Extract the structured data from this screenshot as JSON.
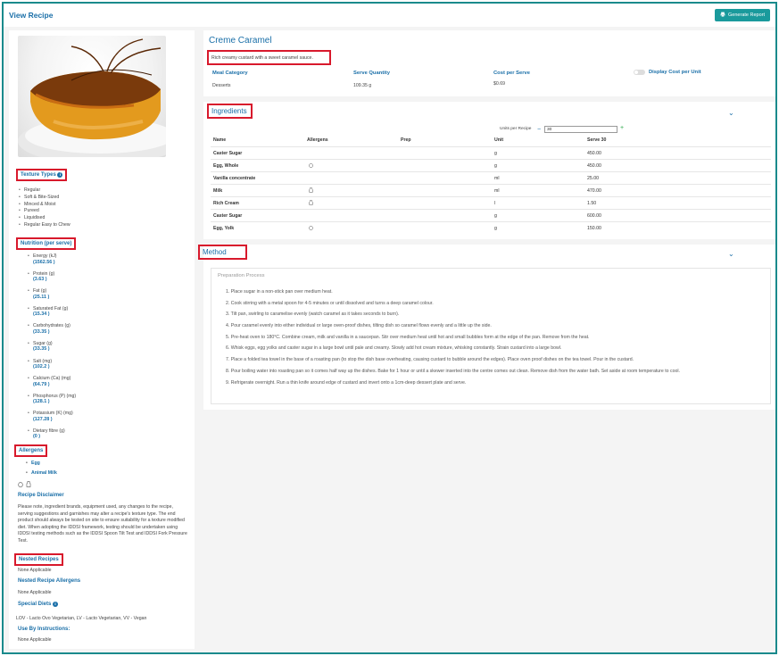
{
  "page": {
    "title": "View Recipe",
    "generate_report": "Generate Report"
  },
  "recipe": {
    "name": "Creme Caramel",
    "description": "Rich creamy custard with a sweet caramel sauce.",
    "meal_category_label": "Meal Category",
    "meal_category": "Desserts",
    "serve_quantity_label": "Serve Quantity",
    "serve_quantity": "109.35 g",
    "cost_per_serve_label": "Cost per Serve",
    "cost_per_serve": "$0.69",
    "display_cost_label": "Display Cost per Unit"
  },
  "sidebar": {
    "texture_types_title": "Texture Types",
    "texture_types": [
      "Regular",
      "Soft & Bite-Sized",
      "Minced & Moist",
      "Pureed",
      "Liquidised",
      "Regular Easy to Chew"
    ],
    "nutrition_title": "Nutrition (per serve)",
    "nutrition": [
      {
        "label": "Energy (kJ)",
        "value": "(1562.56 )"
      },
      {
        "label": "Protein (g)",
        "value": "(3.63 )"
      },
      {
        "label": "Fat (g)",
        "value": "(25.11 )"
      },
      {
        "label": "Saturated Fat (g)",
        "value": "(15.34 )"
      },
      {
        "label": "Carbohydrates (g)",
        "value": "(33.35 )"
      },
      {
        "label": "Sugar (g)",
        "value": "(33.35 )"
      },
      {
        "label": "Salt (mg)",
        "value": "(102.2 )"
      },
      {
        "label": "Calcium (Ca) (mg)",
        "value": "(64.79 )"
      },
      {
        "label": "Phosphorus (P) (mg)",
        "value": "(128.1 )"
      },
      {
        "label": "Potassium (K) (mg)",
        "value": "(127.28 )"
      },
      {
        "label": "Dietary fibre (g)",
        "value": "(0 )"
      }
    ],
    "allergens_title": "Allergens",
    "allergens": [
      "Egg",
      "Animal Milk"
    ],
    "disclaimer_title": "Recipe Disclaimer",
    "disclaimer_text": "Please note, ingredient brands, equipment used, any changes to the recipe, serving suggestions and garnishes may alter a recipe's texture type. The end product should always be tested on site to ensure suitability for a texture modified diet. When adopting the IDDSI framework, testing should be undertaken using IDDSI testing methods such as the IDDSI Spoon Tilt Test and IDDSI Fork Pressure Test.",
    "nested_recipes_title": "Nested Recipes",
    "nested_recipes_value": "None Applicable",
    "nested_allergens_title": "Nested Recipe Allergens",
    "nested_allergens_value": "None Applicable",
    "special_diets_title": "Special Diets",
    "special_diets_value": "LOV - Lacto Ovo Vegetarian, LV - Lacto Vegetarian, VV - Vegan",
    "use_by_title": "Use By Instructions:",
    "use_by_value": "None Applicable"
  },
  "ingredients": {
    "title": "Ingredients",
    "units_per_recipe_label": "Units per Recipe",
    "units_per_recipe_value": "30",
    "columns": [
      "Name",
      "Allergens",
      "Prep",
      "Unit",
      "Serve 30"
    ],
    "rows": [
      {
        "name": "Caster Sugar",
        "allergen": "",
        "prep": "",
        "unit": "g",
        "serve": "450.00"
      },
      {
        "name": "Egg, Whole",
        "allergen": "egg",
        "prep": "",
        "unit": "g",
        "serve": "450.00"
      },
      {
        "name": "Vanilla concentrate",
        "allergen": "",
        "prep": "",
        "unit": "ml",
        "serve": "25.00"
      },
      {
        "name": "Milk",
        "allergen": "milk",
        "prep": "",
        "unit": "ml",
        "serve": "470.00"
      },
      {
        "name": "Rich Cream",
        "allergen": "milk",
        "prep": "",
        "unit": "l",
        "serve": "1.50"
      },
      {
        "name": "Caster Sugar",
        "allergen": "",
        "prep": "",
        "unit": "g",
        "serve": "600.00"
      },
      {
        "name": "Egg, Yolk",
        "allergen": "egg",
        "prep": "",
        "unit": "g",
        "serve": "150.00"
      }
    ]
  },
  "method": {
    "title": "Method",
    "preparation_title": "Preparation Process",
    "steps": [
      "1. Place sugar in a non-stick pan over medium heat.",
      "2. Cook stirring with a metal spoon for 4-5 minutes or until dissolved and turns a deep caramel colour.",
      "3. Tilt pan, swirling to caramelise evenly (watch caramel as it takes seconds to burn).",
      "4. Pour caramel evenly into either individual or large oven-proof dishes, tilting dish so caramel flows evenly and a little up the side.",
      "5. Pre-heat oven to 180°C. Combine cream, milk and vanilla in a saucepan. Stir over medium heat until hot and small bubbles form at the edge of the pan. Remove from the heat.",
      "6. Whisk eggs, egg yolks and caster sugar in a large bowl until pale and creamy. Slowly add hot cream mixture, whisking constantly. Strain custard into a large bowl.",
      "7. Place a folded tea towel in the base of a roasting pan (to stop the dish base overheating, causing custard to bubble around the edges). Place oven proof dishes on the tea towel. Pour in the custard.",
      "8. Pour boiling water into roasting pan so it comes half way up the dishes. Bake for 1 hour or until a skewer inserted into the centre comes out clean. Remove dish from the water bath. Set aside at room temperature to cool.",
      "9. Refrigerate overnight. Run a thin knife around edge of custard and invert onto a 1cm-deep dessert plate and serve."
    ]
  },
  "colors": {
    "accent": "#1a6fa8",
    "teal": "#1a9a9c",
    "highlight": "#d8192c"
  }
}
